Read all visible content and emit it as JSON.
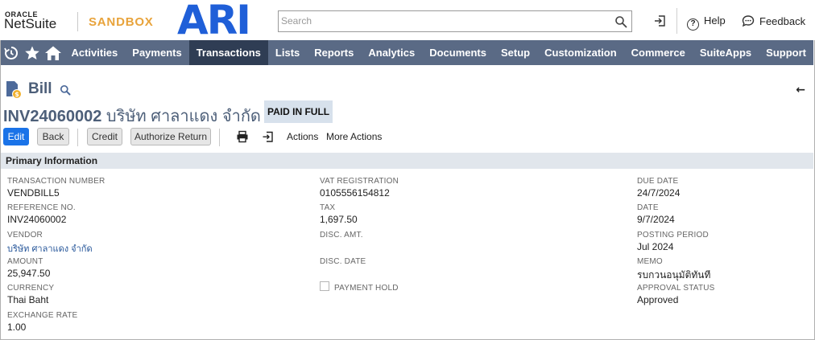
{
  "header": {
    "oracle": "ORACLE",
    "netsuite": "NetSuite",
    "environment": "SANDBOX",
    "brand": "ARI",
    "search_placeholder": "Search",
    "help": "Help",
    "feedback": "Feedback"
  },
  "nav": {
    "items": [
      "Activities",
      "Payments",
      "Transactions",
      "Lists",
      "Reports",
      "Analytics",
      "Documents",
      "Setup",
      "Customization",
      "Commerce",
      "SuiteApps",
      "Support"
    ],
    "active": "Transactions",
    "icons": [
      "recent-history-icon",
      "star-icon",
      "home-icon"
    ]
  },
  "page": {
    "record_type": "Bill",
    "transaction_id": "INV24060002",
    "vendor_name": "บริษัท ศาลาแดง จำกัด",
    "status": "PAID IN FULL",
    "back_arrow": "←"
  },
  "buttons": {
    "edit": "Edit",
    "back": "Back",
    "credit": "Credit",
    "authorize_return": "Authorize Return",
    "actions": "Actions",
    "more_actions": "More Actions"
  },
  "section": {
    "title": "Primary Information"
  },
  "fields": {
    "col1": [
      {
        "label": "TRANSACTION NUMBER",
        "value": "VENDBILL5"
      },
      {
        "label": "REFERENCE NO.",
        "value": "INV24060002"
      },
      {
        "label": "VENDOR",
        "value": "บริษัท ศาลาแดง จำกัด"
      },
      {
        "label": "AMOUNT",
        "value": "25,947.50"
      },
      {
        "label": "CURRENCY",
        "value": "Thai Baht"
      },
      {
        "label": "EXCHANGE RATE",
        "value": "1.00"
      }
    ],
    "col2": [
      {
        "label": "VAT REGISTRATION",
        "value": "0105556154812"
      },
      {
        "label": "TAX",
        "value": "1,697.50"
      },
      {
        "label": "DISC. AMT.",
        "value": ""
      },
      {
        "label": "DISC. DATE",
        "value": ""
      }
    ],
    "payment_hold": {
      "label": "PAYMENT HOLD",
      "checked": false
    },
    "col3": [
      {
        "label": "DUE DATE",
        "value": "24/7/2024"
      },
      {
        "label": "DATE",
        "value": "9/7/2024"
      },
      {
        "label": "POSTING PERIOD",
        "value": "Jul 2024"
      },
      {
        "label": "MEMO",
        "value": "รบกวนอนุมัติทันที"
      },
      {
        "label": "APPROVAL STATUS",
        "value": "Approved"
      }
    ]
  },
  "colors": {
    "nav_bg": "#5a6a85",
    "nav_active": "#2f3d54",
    "primary_button": "#1a73e8",
    "title_color": "#4d5f79",
    "status_bg": "#d7e1ec",
    "sandbox": "#e8a33b",
    "brand": "#1f5fd8"
  }
}
